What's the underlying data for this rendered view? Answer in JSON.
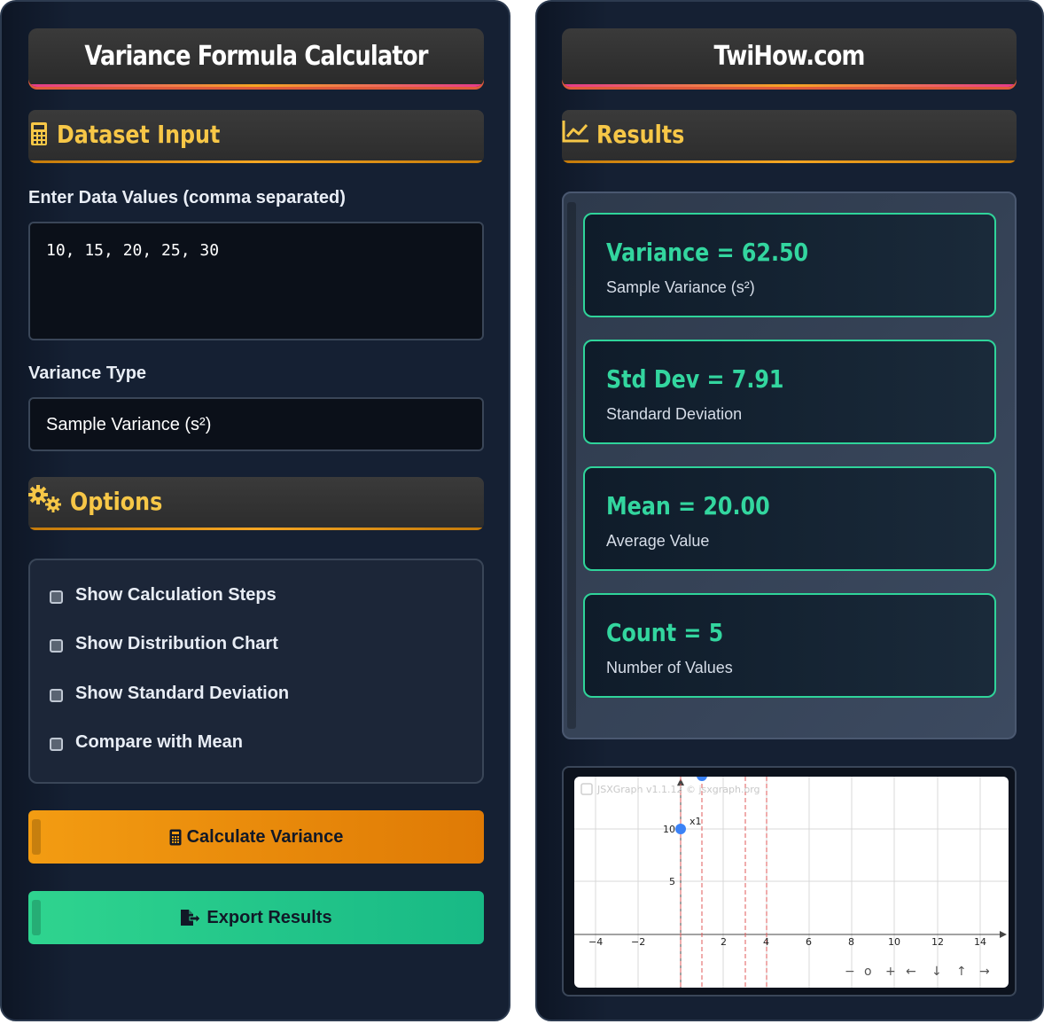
{
  "left": {
    "title": "Variance Formula Calculator",
    "dataset_heading": "Dataset Input",
    "data_label": "Enter Data Values (comma separated)",
    "data_value": "10, 15, 20, 25, 30",
    "type_label": "Variance Type",
    "type_selected": "Sample Variance (s²)",
    "options_heading": "Options",
    "options": [
      {
        "label": "Show Calculation Steps"
      },
      {
        "label": "Show Distribution Chart"
      },
      {
        "label": "Show Standard Deviation"
      },
      {
        "label": "Compare with Mean"
      }
    ],
    "calculate_label": "Calculate Variance",
    "export_label": "Export Results"
  },
  "right": {
    "title": "TwiHow.com",
    "results_heading": "Results",
    "cards": [
      {
        "value": "Variance = 62.50",
        "sub": "Sample Variance (s²)"
      },
      {
        "value": "Std Dev = 7.91",
        "sub": "Standard Deviation"
      },
      {
        "value": "Mean = 20.00",
        "sub": "Average Value"
      },
      {
        "value": "Count = 5",
        "sub": "Number of Values"
      }
    ],
    "graph": {
      "watermark": "JSXGraph v1.1.12 © jsxgraph.org",
      "point_label": "x1",
      "x_ticks": [
        "−4",
        "−2",
        "2",
        "4",
        "6",
        "8",
        "10",
        "12",
        "14"
      ],
      "y_ticks": [
        "5",
        "10"
      ],
      "nav": [
        "−",
        "o",
        "+",
        "←",
        "↓",
        "↑",
        "→"
      ]
    }
  },
  "colors": {
    "accent_yellow": "#f7c747",
    "accent_green": "#33d69f",
    "button_orange": "#f39c12",
    "button_green": "#2fd48f"
  }
}
